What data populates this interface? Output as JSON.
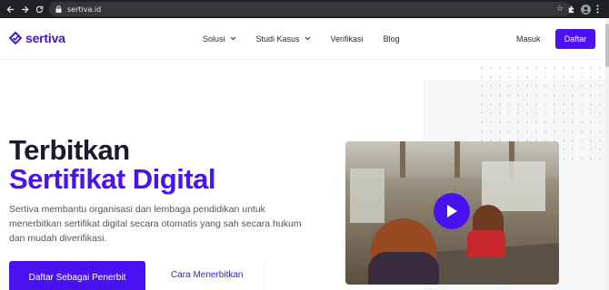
{
  "browser": {
    "url": "sertiva.id",
    "back_icon": "arrow-left-icon",
    "forward_icon": "arrow-right-icon",
    "reload_icon": "reload-icon"
  },
  "brand": {
    "name": "sertiva",
    "accent": "#4a12f0"
  },
  "nav": {
    "items": [
      {
        "label": "Solusi",
        "has_dropdown": true
      },
      {
        "label": "Studi Kasus",
        "has_dropdown": true
      },
      {
        "label": "Verifikasi",
        "has_dropdown": false
      },
      {
        "label": "Blog",
        "has_dropdown": false
      }
    ],
    "login_label": "Masuk",
    "signup_label": "Daftar"
  },
  "hero": {
    "title_line1": "Terbitkan",
    "title_line2": "Sertifikat Digital",
    "description": "Sertiva membantu organisasi dan lembaga pendidikan untuk menerbitkan sertifikat digital secara otomatis yang sah secara hukum dan mudah diverifikasi.",
    "primary_cta": "Daftar Sebagai Penerbit",
    "secondary_cta": "Cara Menerbitkan"
  }
}
